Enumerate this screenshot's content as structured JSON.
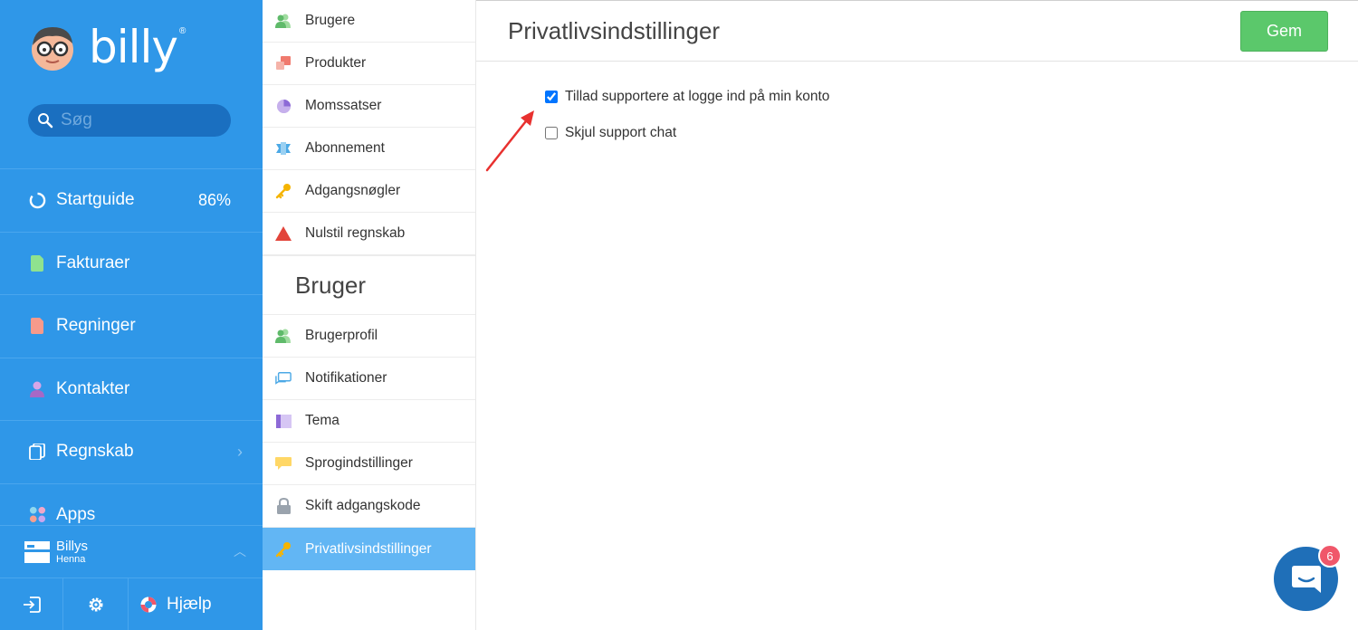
{
  "app": {
    "brand": "billy",
    "brand_mark": "®"
  },
  "search": {
    "placeholder": "Søg"
  },
  "nav": [
    {
      "label": "Startguide",
      "icon": "progress-ring-icon",
      "badge": "86%"
    },
    {
      "label": "Fakturaer",
      "icon": "invoice-icon"
    },
    {
      "label": "Regninger",
      "icon": "bill-icon"
    },
    {
      "label": "Kontakter",
      "icon": "contact-icon"
    },
    {
      "label": "Regnskab",
      "icon": "ledger-icon"
    },
    {
      "label": "Apps",
      "icon": "apps-icon"
    }
  ],
  "org": {
    "name": "Billys",
    "user": "Henna"
  },
  "bottom": {
    "help_label": "Hjælp"
  },
  "settings_menu": {
    "company_items": [
      {
        "label": "Brugere",
        "icon": "users-icon"
      },
      {
        "label": "Produkter",
        "icon": "products-icon"
      },
      {
        "label": "Momssatser",
        "icon": "pie-icon"
      },
      {
        "label": "Abonnement",
        "icon": "subscription-icon"
      },
      {
        "label": "Adgangsnøgler",
        "icon": "key-icon"
      },
      {
        "label": "Nulstil regnskab",
        "icon": "warning-triangle-icon"
      }
    ],
    "user_section_title": "Bruger",
    "user_items": [
      {
        "label": "Brugerprofil",
        "icon": "user-profile-icon"
      },
      {
        "label": "Notifikationer",
        "icon": "chat-bubbles-icon"
      },
      {
        "label": "Tema",
        "icon": "theme-icon"
      },
      {
        "label": "Sprogindstillinger",
        "icon": "speech-bubble-icon"
      },
      {
        "label": "Skift adgangskode",
        "icon": "lock-icon"
      },
      {
        "label": "Privatlivsindstillinger",
        "icon": "key-icon",
        "active": true
      }
    ]
  },
  "page": {
    "title": "Privatlivsindstillinger",
    "save_label": "Gem",
    "options": [
      {
        "label": "Tillad supportere at logge ind på min konto",
        "checked": true
      },
      {
        "label": "Skjul support chat",
        "checked": false
      }
    ]
  },
  "chat_widget": {
    "unread": "6"
  },
  "colors": {
    "sidebar": "#2f97e8",
    "active_menu": "#62b6f4",
    "save_button": "#5bc86b",
    "annotation_arrow": "#e8312f"
  }
}
